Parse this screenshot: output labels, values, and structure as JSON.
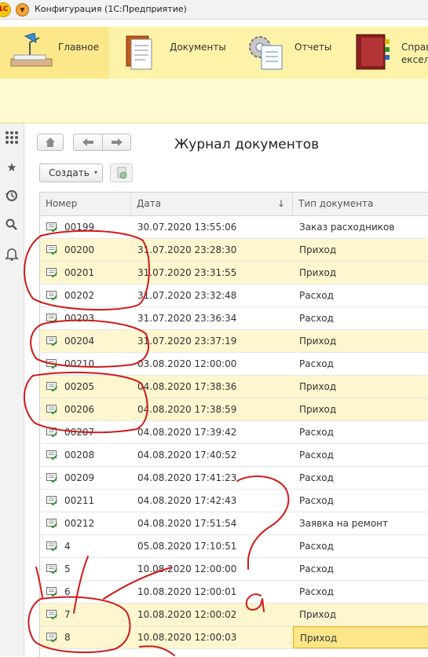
{
  "window": {
    "title": "Конфигурация  (1С:Предприятие)",
    "logo_text": "1С"
  },
  "sections": [
    {
      "label": "Главное",
      "icon": "desk-lamp-icon",
      "active": true
    },
    {
      "label": "Документы",
      "icon": "documents-icon",
      "active": false
    },
    {
      "label": "Отчеты",
      "icon": "reports-gear-icon",
      "active": false
    },
    {
      "label": "Справ",
      "label2": "ексел",
      "icon": "reference-book-icon",
      "active": false
    }
  ],
  "page": {
    "title": "Журнал документов",
    "create_label": "Создать",
    "caret": "▾"
  },
  "table": {
    "headers": {
      "number": "Номер",
      "date": "Дата",
      "type": "Тип документа",
      "sort_indicator": "↓"
    },
    "rows": [
      {
        "number": "00199",
        "date": "30.07.2020 13:55:06",
        "type": "Заказ расходников",
        "highlight": false
      },
      {
        "number": "00200",
        "date": "31.07.2020 23:28:30",
        "type": "Приход",
        "highlight": true
      },
      {
        "number": "00201",
        "date": "31.07.2020 23:31:55",
        "type": "Приход",
        "highlight": true
      },
      {
        "number": "00202",
        "date": "31.07.2020 23:32:48",
        "type": "Расход",
        "highlight": false
      },
      {
        "number": "00203",
        "date": "31.07.2020 23:36:34",
        "type": "Расход",
        "highlight": false
      },
      {
        "number": "00204",
        "date": "31.07.2020 23:37:19",
        "type": "Приход",
        "highlight": true
      },
      {
        "number": "00210",
        "date": "03.08.2020 12:00:00",
        "type": "Расход",
        "highlight": false
      },
      {
        "number": "00205",
        "date": "04.08.2020 17:38:36",
        "type": "Приход",
        "highlight": true
      },
      {
        "number": "00206",
        "date": "04.08.2020 17:38:59",
        "type": "Приход",
        "highlight": true
      },
      {
        "number": "00207",
        "date": "04.08.2020 17:39:42",
        "type": "Расход",
        "highlight": false
      },
      {
        "number": "00208",
        "date": "04.08.2020 17:40:52",
        "type": "Расход",
        "highlight": false
      },
      {
        "number": "00209",
        "date": "04.08.2020 17:41:23",
        "type": "Расход",
        "highlight": false
      },
      {
        "number": "00211",
        "date": "04.08.2020 17:42:43",
        "type": "Расход",
        "highlight": false
      },
      {
        "number": "00212",
        "date": "04.08.2020 17:51:54",
        "type": "Заявка на ремонт",
        "highlight": false
      },
      {
        "number": "4",
        "date": "05.08.2020 17:10:51",
        "type": "Расход",
        "highlight": false
      },
      {
        "number": "5",
        "date": "10.08.2020 12:00:00",
        "type": "Расход",
        "highlight": false
      },
      {
        "number": "6",
        "date": "10.08.2020 12:00:01",
        "type": "Расход",
        "highlight": false
      },
      {
        "number": "7",
        "date": "10.08.2020 12:00:02",
        "type": "Приход",
        "highlight": true
      },
      {
        "number": "8",
        "date": "10.08.2020 12:00:03",
        "type": "Приход",
        "highlight": true,
        "selected": true
      }
    ]
  },
  "annotations": {
    "color": "#d11a1a",
    "question_mark": "?",
    "letter": "a"
  }
}
